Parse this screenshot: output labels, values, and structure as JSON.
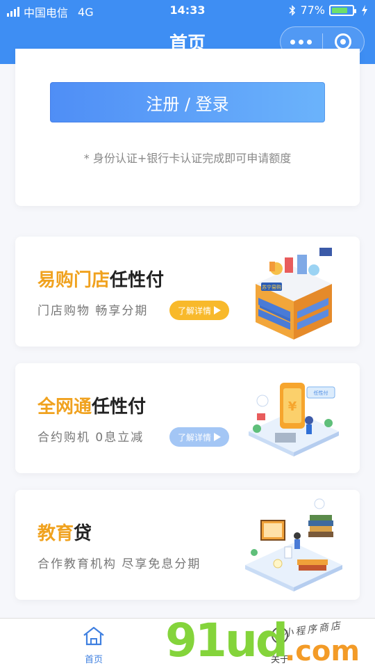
{
  "status_bar": {
    "carrier": "中国电信",
    "network": "4G",
    "time": "14:33",
    "battery": "77%",
    "battery_level": 0.77,
    "icons": [
      "signal-icon",
      "bluetooth-icon",
      "battery-icon",
      "charging-icon"
    ]
  },
  "nav": {
    "title": "首页",
    "menu_icon": "more-dots-icon",
    "close_icon": "target-icon"
  },
  "login": {
    "button_label": "注册 / 登录",
    "hint": "* 身份认证+银行卡认证完成即可申请额度"
  },
  "products": [
    {
      "highlight": "易购门店",
      "title_rest": "任性付",
      "subtitle": "门店购物  畅享分期",
      "button_label": "了解详情",
      "button_color": "#f8b92b"
    },
    {
      "highlight": "全网通",
      "title_rest": "任性付",
      "subtitle": "合约购机  0息立减",
      "button_label": "了解详情",
      "button_color": "#a3c6f5"
    },
    {
      "highlight": "教育",
      "title_rest": "贷",
      "subtitle": "合作教育机构  尽享免息分期"
    }
  ],
  "illustrations": {
    "store_sign": "苏宁易购",
    "phone_sign": "任性付"
  },
  "tab_bar": [
    {
      "label": "首页",
      "icon": "home-icon",
      "active": true
    },
    {
      "label": "关于",
      "icon": "about-icon",
      "active": false
    }
  ],
  "watermark": {
    "brand": "91ud",
    "suffix": ".com",
    "tagline": "小程序商店"
  },
  "colors": {
    "primary": "#3e8ef3",
    "accent_orange": "#f0a21f",
    "button_yellow": "#f8b92b",
    "button_blue": "#a3c6f5"
  }
}
